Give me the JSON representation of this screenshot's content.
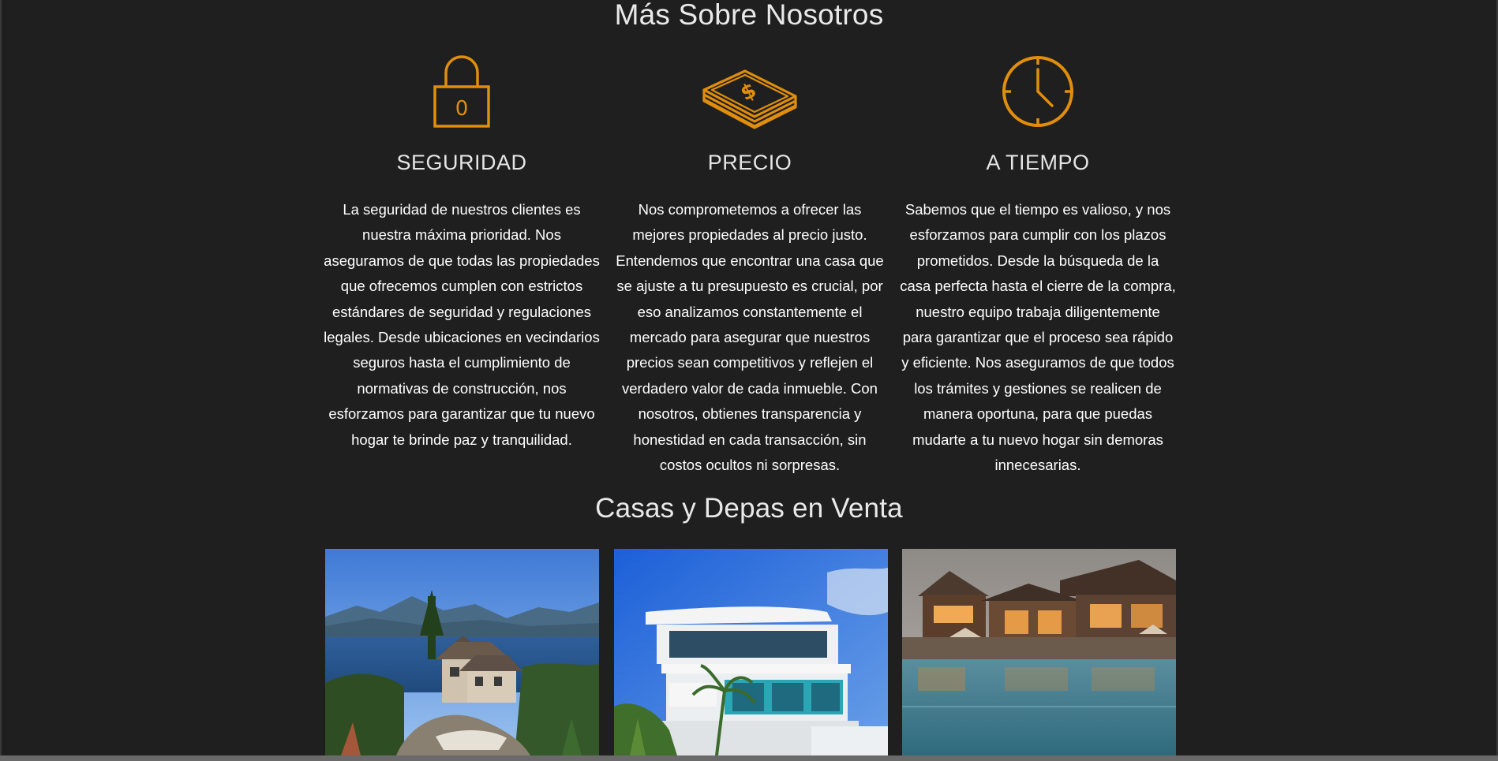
{
  "about": {
    "title": "Más Sobre Nosotros",
    "accent_color": "#e08e0b",
    "features": [
      {
        "icon": "padlock-icon",
        "title": "SEGURIDAD",
        "lock_digit": "0",
        "text": "La seguridad de nuestros clientes es nuestra máxima prioridad. Nos aseguramos de que todas las propiedades que ofrecemos cumplen con estrictos estándares de seguridad y regulaciones legales. Desde ubicaciones en vecindarios seguros hasta el cumplimiento de normativas de construcción, nos esforzamos para garantizar que tu nuevo hogar te brinde paz y tranquilidad."
      },
      {
        "icon": "money-stack-icon",
        "title": "PRECIO",
        "text": "Nos comprometemos a ofrecer las mejores propiedades al precio justo. Entendemos que encontrar una casa que se ajuste a tu presupuesto es crucial, por eso analizamos constantemente el mercado para asegurar que nuestros precios sean competitivos y reflejen el verdadero valor de cada inmueble. Con nosotros, obtienes transparencia y honestidad en cada transacción, sin costos ocultos ni sorpresas."
      },
      {
        "icon": "clock-icon",
        "title": "A TIEMPO",
        "text": "Sabemos que el tiempo es valioso, y nos esforzamos para cumplir con los plazos prometidos. Desde la búsqueda de la casa perfecta hasta el cierre de la compra, nuestro equipo trabaja diligentemente para garantizar que el proceso sea rápido y eficiente. Nos aseguramos de que todos los trámites y gestiones se realicen de manera oportuna, para que puedas mudarte a tu nuevo hogar sin demoras innecesarias."
      }
    ]
  },
  "listings": {
    "title": "Casas y Depas en Venta",
    "cards": [
      {
        "image": "lakeside-house-photo"
      },
      {
        "image": "modern-white-house-photo"
      },
      {
        "image": "lodge-with-pool-photo"
      }
    ]
  }
}
